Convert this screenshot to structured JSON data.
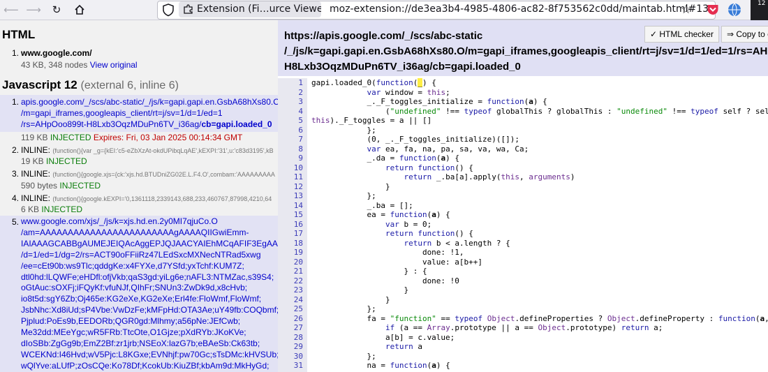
{
  "browser": {
    "back_icon": "arrow-left-icon",
    "forward_icon": "arrow-right-icon",
    "reload_icon": "reload-icon",
    "home_icon": "home-icon",
    "tab_label": "Extension (Fi…urce Viewer)",
    "url": "moz-extension://de3ea3b4-4985-4806-ac82-8f753562c0dd/maintab.html#13",
    "badge_count": "12",
    "accent": "#1a1aa6"
  },
  "left": {
    "html_heading": "HTML",
    "html_items": [
      {
        "num": "1.",
        "url": "www.google.com/",
        "size": "43 KB, 348 nodes",
        "link": "View original"
      }
    ],
    "js_heading": "Javascript 12",
    "js_sub": "(external 6, inline 6)",
    "scripts": [
      {
        "num": "1.",
        "lines": [
          "apis.google.com/_/scs/abc-static/_/js/k=gapi.gapi.en.GsbA68hXs80.O",
          "/m=gapi_iframes,googleapis_client/rt=j/sv=1/d=1/ed=1",
          "/rs=AHpOoo899t-H8Lxb3OqzMDuPn6TV_i36ag/"
        ],
        "bold_tail": "cb=gapi.loaded_0",
        "size": "119 KB",
        "status": "INJECTED",
        "expires": "Expires: Fri, 03 Jan 2025 00:14:34 GMT"
      },
      {
        "num": "2.",
        "label": "INLINE:",
        "snippet": "(function(){var _g={kEI:'c5-eZbXzAt-okdUPibqLqAE',kEXPI:'31',u:'c83d3195',kB",
        "size": "19 KB",
        "status": "INJECTED"
      },
      {
        "num": "3.",
        "label": "INLINE:",
        "snippet": "(function(){google.xjs={ck:'xjs.hd.BTUDniZG02E.L.F4.O',combam:'AAAAAAAAA",
        "size": "590 bytes",
        "status": "INJECTED"
      },
      {
        "num": "4.",
        "label": "INLINE:",
        "snippet": "(function(){google.kEXPI='0,1361118,2339143,688,233,460767,87998,4210,64",
        "size": "6 KB",
        "status": "INJECTED"
      },
      {
        "num": "5.",
        "lines": [
          "www.google.com/xjs/_/js/k=xjs.hd.en.2y0MI7qjuCo.O",
          "/am=AAAAAAAAAAAAAAAAAAAAAAAAgAAAAQIIGwiEmm-",
          "IAIAAAGCABBgAUMEJEIQAcAggEPJQJAACYAIEhMCqAFIF3EgAAm",
          "/d=1/ed=1/dg=2/rs=ACT90oFFiiRz47LEdSxcMXNecNTRad5xwg",
          "/ee=cEt90b:ws9Tlc;qddgKe:x4FYXe,d7YSfd;yxTchf:KUM7Z;",
          "dtl0hd:lLQWFe;eHDfl:ofjVkb;qaS3gd:yiLg6e;nAFL3:NTMZac,s39S4;",
          "oGtAuc:sOXFj;iFQyKf:vfuNJf,QIhFr;SNUn3:ZwDk9d,x8cHvb;",
          "io8t5d:sgY6Zb;Oj465e:KG2eXe,KG2eXe;Erl4fe:FloWmf,FloWmf;",
          "JsbNhc:Xd8iUd;sP4Vbe:VwDzFe;kMFpHd:OTA3Ae;uY49fb:COQbmf;",
          "Pjplud:PoEs9b,EEDORb;QGR0gd:Mlhmy;a56pNe:JEfCwb;",
          "Me32dd:MEeYgc;wR5FRb:TtcOte,O1Gjze;pXdRYb:JKoKVe;",
          "dIoSBb:ZgGg9b;EmZ2Bf:zr1jrb;NSEoX:lazG7b;eBAeSb:Ck63tb;",
          "WCEKNd:I46Hvd;wV5Pjc:L8KGxe;EVNhjf:pw70Gc;sTsDMc:kHVSUb;",
          "wQlYve:aLUfP;zOsCQe:Ko78Df;KcokUb:KiuZBf;kbAm9d:MkHyGd;"
        ]
      }
    ]
  },
  "right": {
    "url_lines": [
      "https://apis.google.com/_/scs/abc-static",
      "/_/js/k=gapi.gapi.en.GsbA68hXs80.O/m=gapi_iframes,googleapis_client/rt=j/sv=1/d=1/ed=1/rs=AH",
      "H8Lxb3OqzMDuPn6TV_i36ag/cb=gapi.loaded_0"
    ],
    "html_checker_label": "✓ HTML checker",
    "copy_label": "⇒ Copy to c",
    "line_numbers": [
      "1",
      "2",
      "3",
      "4",
      "5",
      "6",
      "7",
      "8",
      "9",
      "10",
      "11",
      "12",
      "13",
      "14",
      "15",
      "16",
      "17",
      "18",
      "19",
      "20",
      "21",
      "22",
      "23",
      "24",
      "25",
      "26",
      "27",
      "28",
      "29",
      "30",
      "31"
    ]
  }
}
